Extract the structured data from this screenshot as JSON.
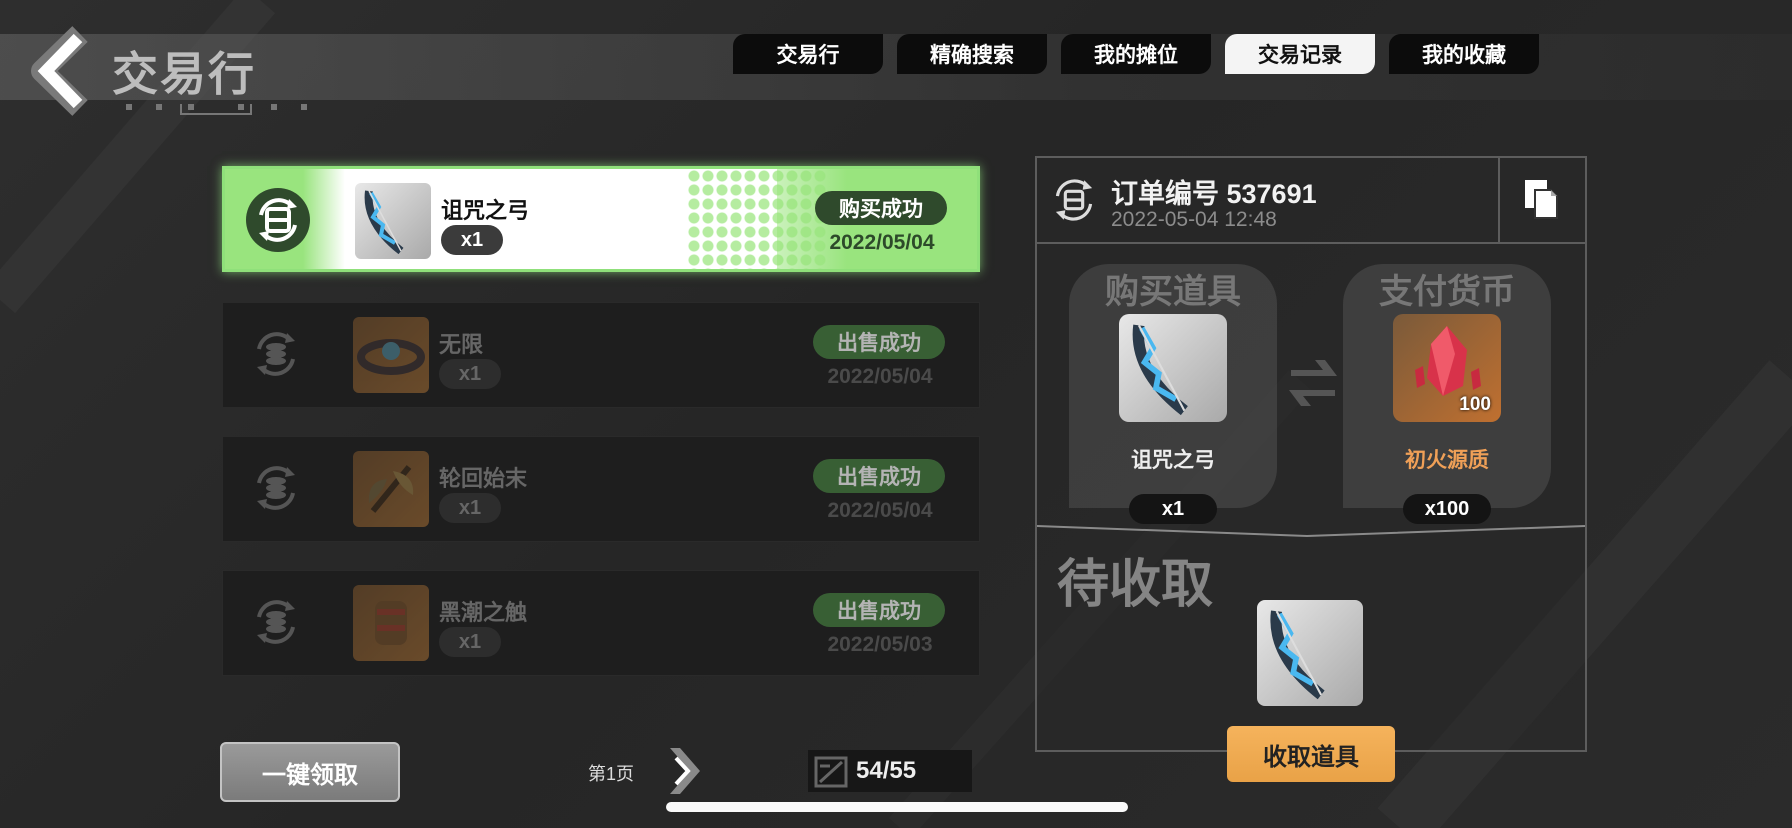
{
  "header": {
    "title": "交易行",
    "tabs": [
      {
        "label": "交易行",
        "active": false
      },
      {
        "label": "精确搜索",
        "active": false
      },
      {
        "label": "我的摊位",
        "active": false
      },
      {
        "label": "交易记录",
        "active": true
      },
      {
        "label": "我的收藏",
        "active": false
      }
    ]
  },
  "records": [
    {
      "name": "诅咒之弓",
      "qty": "x1",
      "status": "购买成功",
      "date": "2022/05/04",
      "selected": true,
      "icon": "bow-icon"
    },
    {
      "name": "无限",
      "qty": "x1",
      "status": "出售成功",
      "date": "2022/05/04",
      "selected": false,
      "icon": "belt-icon"
    },
    {
      "name": "轮回始末",
      "qty": "x1",
      "status": "出售成功",
      "date": "2022/05/04",
      "selected": false,
      "icon": "axe-icon"
    },
    {
      "name": "黑潮之触",
      "qty": "x1",
      "status": "出售成功",
      "date": "2022/05/03",
      "selected": false,
      "icon": "gauntlet-icon"
    }
  ],
  "bottom": {
    "claim_all_label": "一键领取",
    "page_label": "第1页",
    "capacity": "54/55"
  },
  "detail": {
    "order_number": "订单编号 537691",
    "order_time": "2022-05-04 12:48",
    "buy_card": {
      "title": "购买道具",
      "name": "诅咒之弓",
      "qty": "x1"
    },
    "pay_card": {
      "title": "支付货币",
      "name": "初火源质",
      "qty": "x100",
      "badge": "100"
    },
    "pending_title": "待收取",
    "collect_label": "收取道具"
  },
  "colors": {
    "selected_green": "#99e47e",
    "status_green": "#3d6b39",
    "collect_orange": "#f0ab52",
    "currency_name": "#f0a057"
  }
}
